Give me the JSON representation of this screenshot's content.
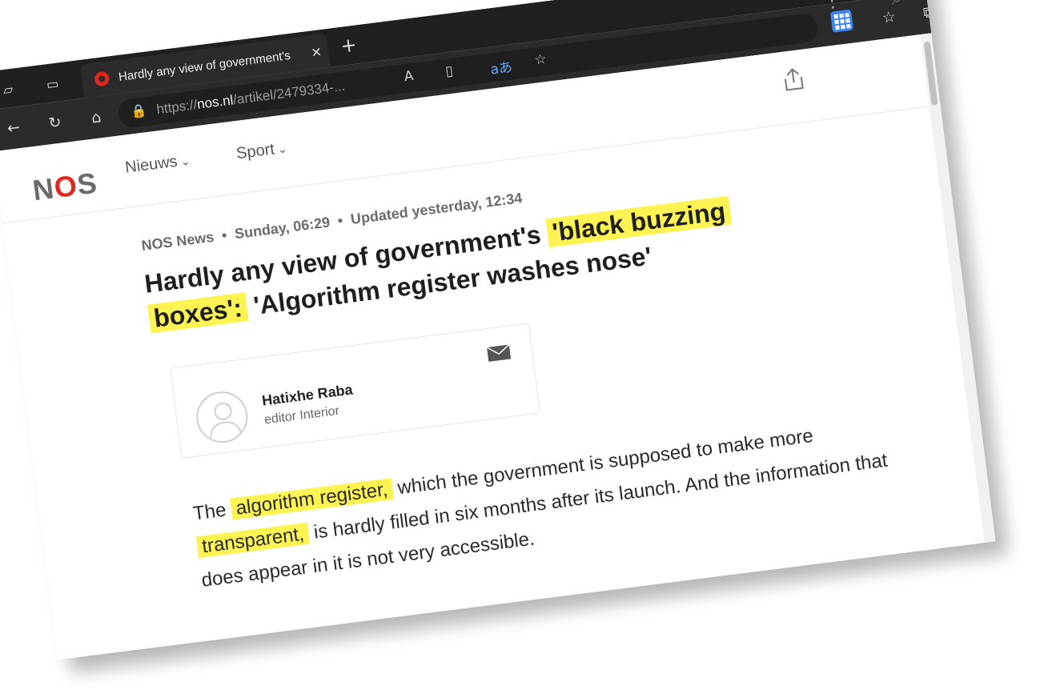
{
  "browser": {
    "tab_title": "Hardly any view of government's",
    "tab_close": "✕",
    "new_tab": "+",
    "window_controls": "▢ ▭ ✕",
    "url_prefix": "https://",
    "url_domain": "nos.nl",
    "url_path": "/artikel/2479334-...",
    "more": "···"
  },
  "site": {
    "logo_n": "N",
    "logo_o": "O",
    "logo_s": "S",
    "nav": [
      {
        "label": "Nieuws",
        "chevron": "⌄"
      },
      {
        "label": "Sport",
        "chevron": "⌄"
      }
    ]
  },
  "article": {
    "source": "NOS News",
    "published": "Sunday, 06:29",
    "updated": "Updated yesterday, 12:34",
    "dot": "•",
    "headline_part1": "Hardly any view of government's ",
    "headline_highlight1": "'black buzzing",
    "headline_part2": " ",
    "headline_highlight2": "boxes':",
    "headline_part3": " 'Algorithm register washes nose'",
    "author_name": "Hatixhe Raba",
    "author_role": "editor Interior",
    "lead_part1": "The ",
    "lead_highlight1": "algorithm register,",
    "lead_part2": " which the government is supposed to make more ",
    "lead_highlight2": "transparent,",
    "lead_part3": " is hardly filled in six months after its launch. And the information that does appear in it is not very accessible."
  },
  "colors": {
    "highlight": "#fdf352",
    "brand_red": "#e1261c",
    "chrome_dark": "#202020"
  }
}
